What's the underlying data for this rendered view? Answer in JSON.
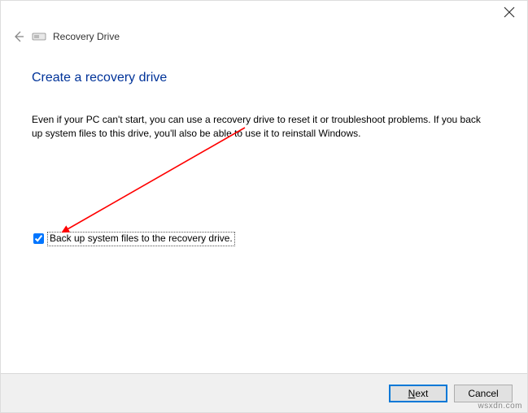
{
  "window": {
    "header_title": "Recovery Drive"
  },
  "page": {
    "title": "Create a recovery drive",
    "description": "Even if your PC can't start, you can use a recovery drive to reset it or troubleshoot problems. If you back up system files to this drive, you'll also be able to use it to reinstall Windows."
  },
  "checkbox": {
    "label": "Back up system files to the recovery drive.",
    "checked": true
  },
  "buttons": {
    "next_prefix": "N",
    "next_rest": "ext",
    "cancel": "Cancel"
  },
  "watermark": "wsxdn.com",
  "colors": {
    "accent": "#0078d7",
    "title": "#003399",
    "arrow": "#ff0000"
  }
}
